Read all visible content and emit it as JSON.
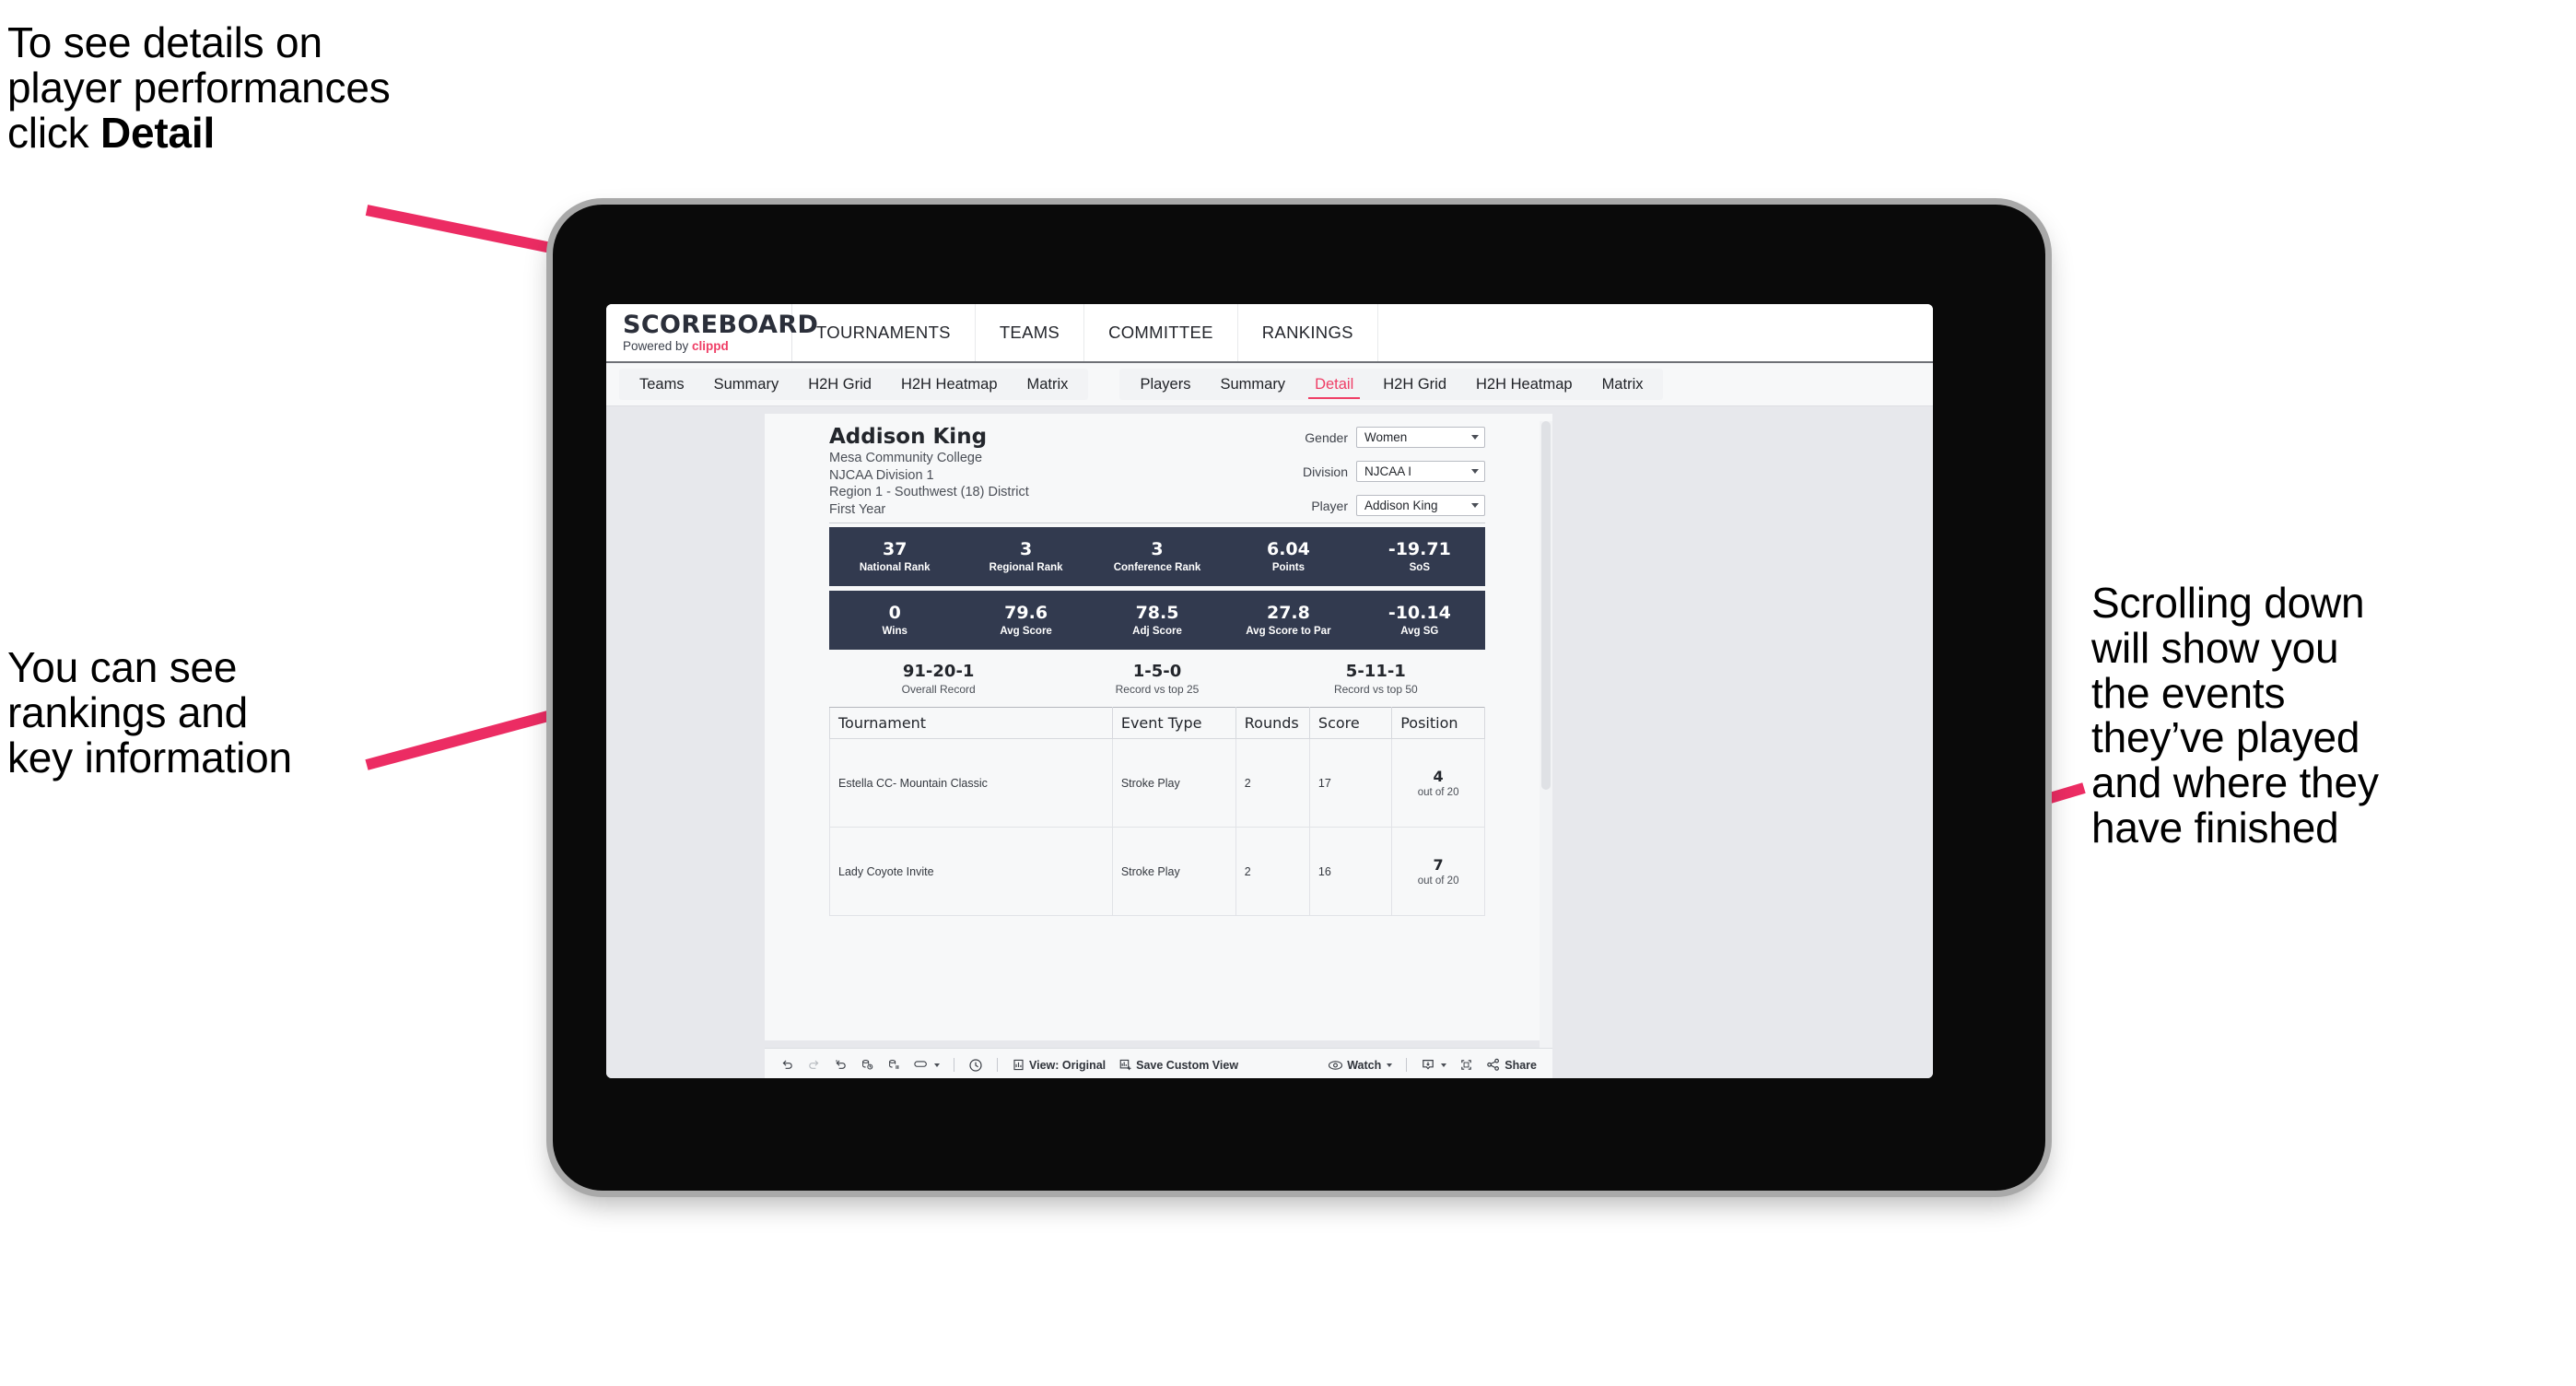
{
  "annotations": {
    "top_left": "To see details on\nplayer performances\nclick ",
    "top_left_bold": "Detail",
    "mid_left": "You can see\nrankings and\nkey information",
    "right": "Scrolling down\nwill show you\nthe events\nthey’ve played\nand where they\nhave finished"
  },
  "colors": {
    "accent_pink": "#ef3e66",
    "arrow_pink": "#ec2c63",
    "stat_bar_navy": "#323a4f",
    "screen_bg": "#e7e8ec"
  },
  "app": {
    "brand": {
      "title": "SCOREBOARD",
      "powered_prefix": "Powered by ",
      "powered_name": "clippd"
    },
    "top_menu": [
      "TOURNAMENTS",
      "TEAMS",
      "COMMITTEE",
      "RANKINGS"
    ],
    "tab_groups": [
      {
        "name": "teams-group",
        "tabs": [
          {
            "label": "Teams",
            "active": false
          },
          {
            "label": "Summary",
            "active": false
          },
          {
            "label": "H2H Grid",
            "active": false
          },
          {
            "label": "H2H Heatmap",
            "active": false
          },
          {
            "label": "Matrix",
            "active": false
          }
        ]
      },
      {
        "name": "players-group",
        "tabs": [
          {
            "label": "Players",
            "active": false
          },
          {
            "label": "Summary",
            "active": false
          },
          {
            "label": "Detail",
            "active": true
          },
          {
            "label": "H2H Grid",
            "active": false
          },
          {
            "label": "H2H Heatmap",
            "active": false
          },
          {
            "label": "Matrix",
            "active": false
          }
        ]
      }
    ],
    "player": {
      "name": "Addison King",
      "school": "Mesa Community College",
      "division": "NJCAA Division 1",
      "region": "Region 1 - Southwest (18) District",
      "year": "First Year"
    },
    "filters": [
      {
        "label": "Gender",
        "value": "Women"
      },
      {
        "label": "Division",
        "value": "NJCAA I"
      },
      {
        "label": "Player",
        "value": "Addison King"
      }
    ],
    "stat_rows": [
      [
        {
          "value": "37",
          "label": "National Rank"
        },
        {
          "value": "3",
          "label": "Regional Rank"
        },
        {
          "value": "3",
          "label": "Conference Rank"
        },
        {
          "value": "6.04",
          "label": "Points"
        },
        {
          "value": "-19.71",
          "label": "SoS"
        }
      ],
      [
        {
          "value": "0",
          "label": "Wins"
        },
        {
          "value": "79.6",
          "label": "Avg Score"
        },
        {
          "value": "78.5",
          "label": "Adj Score"
        },
        {
          "value": "27.8",
          "label": "Avg Score to Par"
        },
        {
          "value": "-10.14",
          "label": "Avg SG"
        }
      ]
    ],
    "records": [
      {
        "value": "91-20-1",
        "label": "Overall Record"
      },
      {
        "value": "1-5-0",
        "label": "Record vs top 25"
      },
      {
        "value": "5-11-1",
        "label": "Record vs top 50"
      }
    ],
    "events_table": {
      "headers": [
        "Tournament",
        "Event Type",
        "Rounds",
        "Score",
        "Position"
      ],
      "rows": [
        {
          "tournament": "Estella CC- Mountain Classic",
          "event_type": "Stroke Play",
          "rounds": "2",
          "score": "17",
          "position": "4",
          "position_sub": "out of 20"
        },
        {
          "tournament": "Lady Coyote Invite",
          "event_type": "Stroke Play",
          "rounds": "2",
          "score": "16",
          "position": "7",
          "position_sub": "out of 20"
        }
      ]
    },
    "bottom_toolbar": {
      "view_label": "View: Original",
      "save_label": "Save Custom View",
      "watch_label": "Watch",
      "share_label": "Share"
    }
  }
}
